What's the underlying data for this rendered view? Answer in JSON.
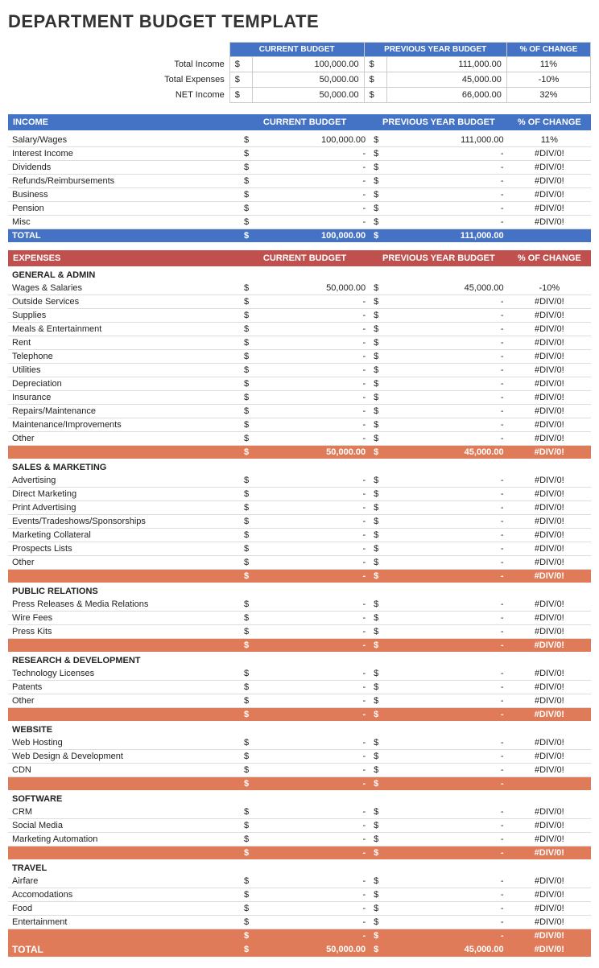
{
  "title": "DEPARTMENT BUDGET TEMPLATE",
  "summary": {
    "headers": [
      "CURRENT BUDGET",
      "PREVIOUS YEAR BUDGET",
      "% OF CHANGE"
    ],
    "rows": [
      {
        "label": "Total Income",
        "curr_dollar": "$",
        "curr_val": "100,000.00",
        "prev_dollar": "$",
        "prev_val": "111,000.00",
        "pct": "11%"
      },
      {
        "label": "Total Expenses",
        "curr_dollar": "$",
        "curr_val": "50,000.00",
        "prev_dollar": "$",
        "prev_val": "45,000.00",
        "pct": "-10%"
      },
      {
        "label": "NET Income",
        "curr_dollar": "$",
        "curr_val": "50,000.00",
        "prev_dollar": "$",
        "prev_val": "66,000.00",
        "pct": "32%"
      }
    ]
  },
  "income": {
    "section_label": "INCOME",
    "col_headers": [
      "CURRENT BUDGET",
      "PREVIOUS YEAR BUDGET",
      "% OF CHANGE"
    ],
    "rows": [
      {
        "label": "Salary/Wages",
        "curr": "100,000.00",
        "prev": "111,000.00",
        "pct": "11%"
      },
      {
        "label": "Interest Income",
        "curr": "-",
        "prev": "-",
        "pct": "#DIV/0!"
      },
      {
        "label": "Dividends",
        "curr": "-",
        "prev": "-",
        "pct": "#DIV/0!"
      },
      {
        "label": "Refunds/Reimbursements",
        "curr": "-",
        "prev": "-",
        "pct": "#DIV/0!"
      },
      {
        "label": "Business",
        "curr": "-",
        "prev": "-",
        "pct": "#DIV/0!"
      },
      {
        "label": "Pension",
        "curr": "-",
        "prev": "-",
        "pct": "#DIV/0!"
      },
      {
        "label": "Misc",
        "curr": "-",
        "prev": "-",
        "pct": "#DIV/0!"
      }
    ],
    "total_label": "TOTAL",
    "total_curr": "100,000.00",
    "total_prev": "111,000.00",
    "total_pct": ""
  },
  "expenses": {
    "section_label": "EXPENSES",
    "col_headers": [
      "CURRENT BUDGET",
      "PREVIOUS YEAR BUDGET",
      "% OF CHANGE"
    ],
    "groups": [
      {
        "name": "GENERAL & ADMIN",
        "rows": [
          {
            "label": "Wages & Salaries",
            "curr": "50,000.00",
            "prev": "45,000.00",
            "pct": "-10%"
          },
          {
            "label": "Outside Services",
            "curr": "-",
            "prev": "-",
            "pct": "#DIV/0!"
          },
          {
            "label": "Supplies",
            "curr": "-",
            "prev": "-",
            "pct": "#DIV/0!"
          },
          {
            "label": "Meals & Entertainment",
            "curr": "-",
            "prev": "-",
            "pct": "#DIV/0!"
          },
          {
            "label": "Rent",
            "curr": "-",
            "prev": "-",
            "pct": "#DIV/0!"
          },
          {
            "label": "Telephone",
            "curr": "-",
            "prev": "-",
            "pct": "#DIV/0!"
          },
          {
            "label": "Utilities",
            "curr": "-",
            "prev": "-",
            "pct": "#DIV/0!"
          },
          {
            "label": "Depreciation",
            "curr": "-",
            "prev": "-",
            "pct": "#DIV/0!"
          },
          {
            "label": "Insurance",
            "curr": "-",
            "prev": "-",
            "pct": "#DIV/0!"
          },
          {
            "label": "Repairs/Maintenance",
            "curr": "-",
            "prev": "-",
            "pct": "#DIV/0!"
          },
          {
            "label": "Maintenance/Improvements",
            "curr": "-",
            "prev": "-",
            "pct": "#DIV/0!"
          },
          {
            "label": "Other",
            "curr": "-",
            "prev": "-",
            "pct": "#DIV/0!"
          }
        ],
        "subtotal_curr": "50,000.00",
        "subtotal_prev": "45,000.00",
        "subtotal_pct": "#DIV/0!"
      },
      {
        "name": "SALES & MARKETING",
        "rows": [
          {
            "label": "Advertising",
            "curr": "-",
            "prev": "-",
            "pct": "#DIV/0!"
          },
          {
            "label": "Direct Marketing",
            "curr": "-",
            "prev": "-",
            "pct": "#DIV/0!"
          },
          {
            "label": "Print Advertising",
            "curr": "-",
            "prev": "-",
            "pct": "#DIV/0!"
          },
          {
            "label": "Events/Tradeshows/Sponsorships",
            "curr": "-",
            "prev": "-",
            "pct": "#DIV/0!"
          },
          {
            "label": "Marketing Collateral",
            "curr": "-",
            "prev": "-",
            "pct": "#DIV/0!"
          },
          {
            "label": "Prospects Lists",
            "curr": "-",
            "prev": "-",
            "pct": "#DIV/0!"
          },
          {
            "label": "Other",
            "curr": "-",
            "prev": "-",
            "pct": "#DIV/0!"
          }
        ],
        "subtotal_curr": "-",
        "subtotal_prev": "-",
        "subtotal_pct": "#DIV/0!"
      },
      {
        "name": "PUBLIC RELATIONS",
        "rows": [
          {
            "label": "Press Releases & Media Relations",
            "curr": "-",
            "prev": "-",
            "pct": "#DIV/0!"
          },
          {
            "label": "Wire Fees",
            "curr": "-",
            "prev": "-",
            "pct": "#DIV/0!"
          },
          {
            "label": "Press Kits",
            "curr": "-",
            "prev": "-",
            "pct": "#DIV/0!"
          }
        ],
        "subtotal_curr": "-",
        "subtotal_prev": "-",
        "subtotal_pct": "#DIV/0!"
      },
      {
        "name": "RESEARCH & DEVELOPMENT",
        "rows": [
          {
            "label": "Technology Licenses",
            "curr": "-",
            "prev": "-",
            "pct": "#DIV/0!"
          },
          {
            "label": "Patents",
            "curr": "-",
            "prev": "-",
            "pct": "#DIV/0!"
          },
          {
            "label": "Other",
            "curr": "-",
            "prev": "-",
            "pct": "#DIV/0!"
          }
        ],
        "subtotal_curr": "-",
        "subtotal_prev": "-",
        "subtotal_pct": "#DIV/0!"
      },
      {
        "name": "WEBSITE",
        "rows": [
          {
            "label": "Web Hosting",
            "curr": "-",
            "prev": "-",
            "pct": "#DIV/0!"
          },
          {
            "label": "Web Design & Development",
            "curr": "-",
            "prev": "-",
            "pct": "#DIV/0!"
          },
          {
            "label": "CDN",
            "curr": "-",
            "prev": "-",
            "pct": "#DIV/0!"
          }
        ],
        "subtotal_curr": "-",
        "subtotal_prev": "-",
        "subtotal_pct": ""
      },
      {
        "name": "SOFTWARE",
        "rows": [
          {
            "label": "CRM",
            "curr": "-",
            "prev": "-",
            "pct": "#DIV/0!"
          },
          {
            "label": "Social Media",
            "curr": "-",
            "prev": "-",
            "pct": "#DIV/0!"
          },
          {
            "label": "Marketing Automation",
            "curr": "-",
            "prev": "-",
            "pct": "#DIV/0!"
          }
        ],
        "subtotal_curr": "-",
        "subtotal_prev": "-",
        "subtotal_pct": "#DIV/0!"
      },
      {
        "name": "TRAVEL",
        "rows": [
          {
            "label": "Airfare",
            "curr": "-",
            "prev": "-",
            "pct": "#DIV/0!"
          },
          {
            "label": "Accomodations",
            "curr": "-",
            "prev": "-",
            "pct": "#DIV/0!"
          },
          {
            "label": "Food",
            "curr": "-",
            "prev": "-",
            "pct": "#DIV/0!"
          },
          {
            "label": "Entertainment",
            "curr": "-",
            "prev": "-",
            "pct": "#DIV/0!"
          }
        ],
        "subtotal_curr": "-",
        "subtotal_prev": "-",
        "subtotal_pct": "#DIV/0!"
      }
    ],
    "total_label": "TOTAL",
    "total_curr": "50,000.00",
    "total_prev": "45,000.00",
    "total_pct": "#DIV/0!"
  }
}
